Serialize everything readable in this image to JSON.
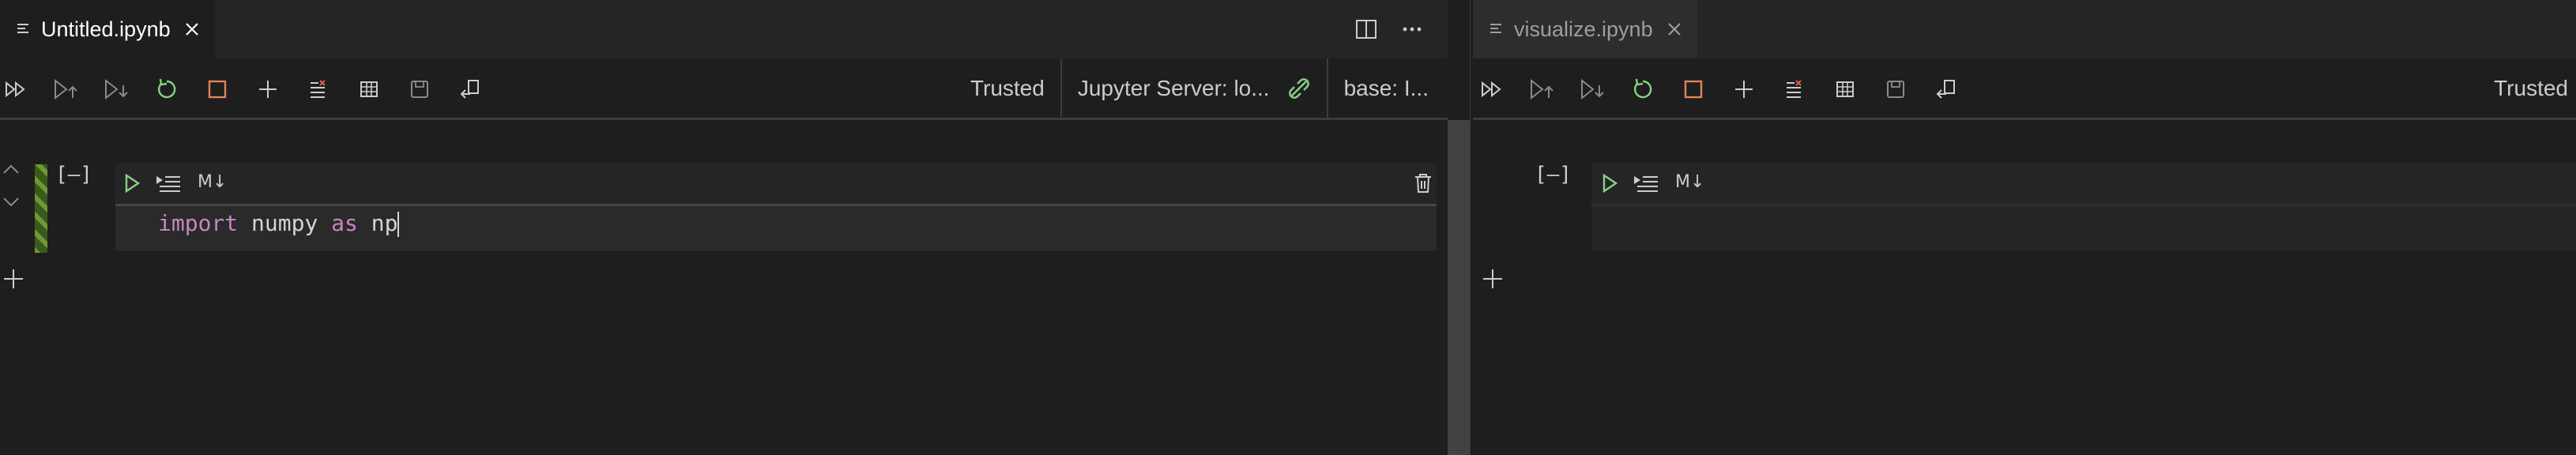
{
  "left_editor": {
    "tab": {
      "label": "Untitled.ipynb",
      "icon": "notebook-file-icon",
      "close_icon": "close-icon"
    },
    "tab_actions": {
      "split": "split-editor-icon",
      "more": "more-actions-icon"
    },
    "toolbar": {
      "buttons": [
        "run-all-icon",
        "run-above-icon",
        "run-below-icon",
        "restart-kernel-icon",
        "interrupt-kernel-icon",
        "add-cell-icon",
        "clear-outputs-icon",
        "variables-icon",
        "save-icon",
        "export-icon"
      ],
      "trusted": "Trusted",
      "server": "Jupyter Server: lo...",
      "kernel": "base: I..."
    },
    "cell": {
      "exec_count": "[–]",
      "markdown_toggle": "M↓",
      "code": {
        "keyword1": "import",
        "module": " numpy ",
        "keyword2": "as",
        "alias": " np"
      }
    }
  },
  "right_editor": {
    "tab": {
      "label": "visualize.ipynb",
      "icon": "notebook-file-icon",
      "close_icon": "close-icon"
    },
    "toolbar": {
      "trusted": "Trusted"
    },
    "cell": {
      "exec_count": "[–]",
      "markdown_toggle": "M↓"
    }
  },
  "colors": {
    "run_green": "#89d185",
    "restart_green": "#89d185",
    "stop_orange": "#e0835a",
    "keyword_purple": "#c586c0",
    "selected_cell_green": "#4e7a27"
  }
}
